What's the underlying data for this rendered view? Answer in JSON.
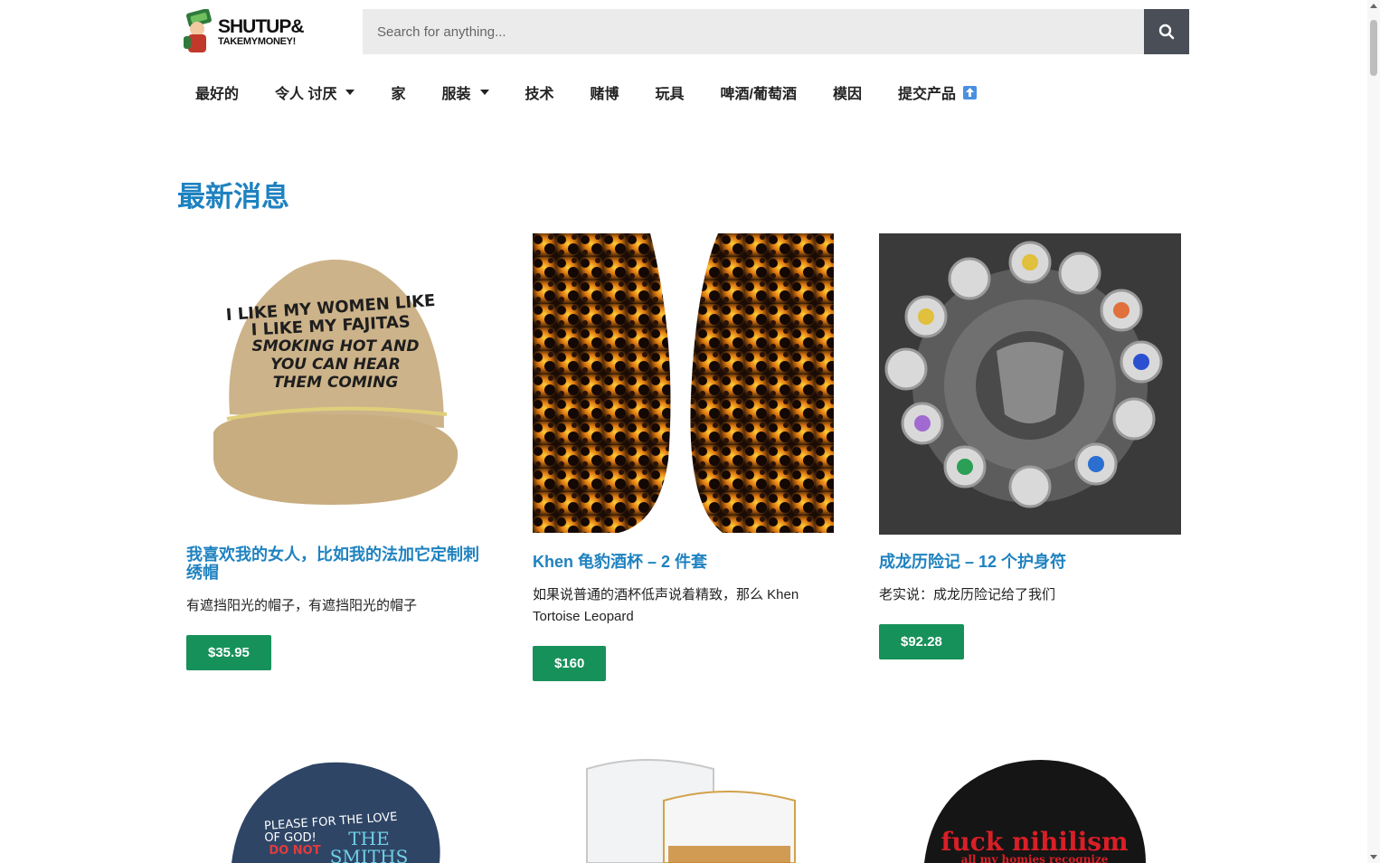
{
  "header": {
    "logo_line1": "SHUTUP&",
    "logo_line2": "TAKEMYMONEY!",
    "search_placeholder": "Search for anything...",
    "search_icon": "search-icon"
  },
  "nav": {
    "items": [
      {
        "label": "最好的",
        "has_dropdown": false
      },
      {
        "label": "令人 讨厌",
        "has_dropdown": true
      },
      {
        "label": "家",
        "has_dropdown": false
      },
      {
        "label": "服装",
        "has_dropdown": true
      },
      {
        "label": "技术",
        "has_dropdown": false
      },
      {
        "label": "赌博",
        "has_dropdown": false
      },
      {
        "label": "玩具",
        "has_dropdown": false
      },
      {
        "label": "啤酒/葡萄酒",
        "has_dropdown": false
      },
      {
        "label": "模因",
        "has_dropdown": false
      },
      {
        "label": "提交产品",
        "has_dropdown": false,
        "badge_icon": "up-arrow-icon"
      }
    ]
  },
  "main": {
    "section_title": "最新消息",
    "products": [
      {
        "image": "khaki-cap-image",
        "cap_text": [
          "I LIKE MY WOMEN LIKE",
          "I LIKE MY FAJITAS",
          "SMOKING HOT AND",
          "YOU CAN HEAR",
          "THEM COMING"
        ],
        "title": "我喜欢我的女人，比如我的法加它定制刺绣帽",
        "description": "有遮挡阳光的帽子，有遮挡阳光的帽子",
        "price": "$35.95"
      },
      {
        "image": "tortoise-wine-glasses-image",
        "title": "Khen 龟豹酒杯 – 2 件套",
        "description": "如果说普通的酒杯低声说着精致，那么 Khen Tortoise Leopard",
        "price": "$160"
      },
      {
        "image": "jackie-chan-talismans-image",
        "title": "成龙历险记 – 12 个护身符",
        "description": "老实说：成龙历险记给了我们",
        "price": "$92.28"
      }
    ],
    "next_row": [
      {
        "image": "navy-cap-image",
        "cap_text": [
          "PLEASE FOR THE LOVE",
          "OF GOD!",
          "DO NOT",
          "THE",
          "SMITHS"
        ]
      },
      {
        "image": "whiskey-glasses-image"
      },
      {
        "image": "black-cap-image",
        "cap_text": [
          "fuck nihilism",
          "all my homies recognize"
        ]
      }
    ]
  },
  "colors": {
    "accent_blue": "#1f82c0",
    "price_green": "#17915a",
    "search_button": "#4a4e57",
    "search_bg": "#ebebeb"
  }
}
